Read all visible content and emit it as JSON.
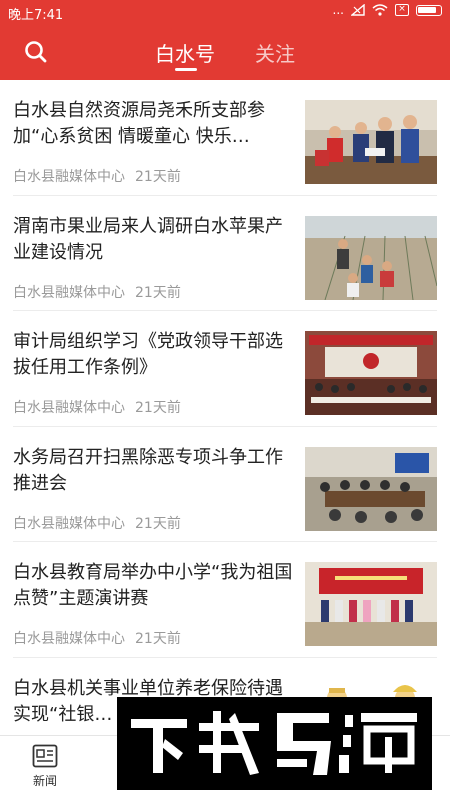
{
  "status_bar": {
    "time": "晚上7:41",
    "dots": "..."
  },
  "header": {
    "tabs": [
      {
        "label": "白水号",
        "active": true
      },
      {
        "label": "关注",
        "active": false
      }
    ]
  },
  "feed": [
    {
      "title": "白水县自然资源局尧禾所支部参加“心系贫困 情暖童心 快乐…",
      "source": "白水县融媒体中心",
      "time": "21天前",
      "thumb": "classroom-ceremony-photo"
    },
    {
      "title": "渭南市果业局来人调研白水苹果产业建设情况",
      "source": "白水县融媒体中心",
      "time": "21天前",
      "thumb": "orchard-field-photo"
    },
    {
      "title": "审计局组织学习《党政领导干部选拔任用工作条例》",
      "source": "白水县融媒体中心",
      "time": "21天前",
      "thumb": "meeting-hall-photo"
    },
    {
      "title": "水务局召开扫黑除恶专项斗争工作推进会",
      "source": "白水县融媒体中心",
      "time": "21天前",
      "thumb": "conference-table-photo"
    },
    {
      "title": "白水县教育局举办中小学“我为祖国点赞”主题演讲赛",
      "source": "白水县融媒体中心",
      "time": "21天前",
      "thumb": "stage-performance-photo"
    },
    {
      "title": "白水县机关事业单位养老保险待遇实现“社银…",
      "source": "",
      "time": "",
      "thumb": "cartoon-illustration"
    }
  ],
  "tabbar": {
    "items": [
      {
        "label": "新闻",
        "icon": "news-icon"
      }
    ]
  },
  "colors": {
    "brand_red": "#e23a33",
    "meta_gray": "#9a9a9a"
  }
}
